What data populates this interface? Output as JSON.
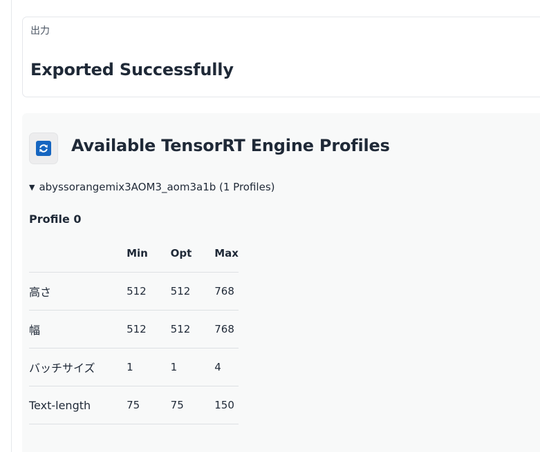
{
  "output": {
    "label": "出力",
    "message": "Exported Successfully"
  },
  "profiles_panel": {
    "title": "Available TensorRT Engine Profiles",
    "refresh_icon": "refresh-icon",
    "colors": {
      "icon_blue": "#1565c0",
      "panel_bg": "#f8f9f9"
    },
    "model": {
      "caret": "▼",
      "summary": "abyssorangemix3AOM3_aom3a1b (1 Profiles)"
    },
    "profile": {
      "heading": "Profile 0",
      "columns": [
        "",
        "Min",
        "Opt",
        "Max"
      ],
      "rows": [
        {
          "param": "高さ",
          "min": "512",
          "opt": "512",
          "max": "768"
        },
        {
          "param": "幅",
          "min": "512",
          "opt": "512",
          "max": "768"
        },
        {
          "param": "バッチサイズ",
          "min": "1",
          "opt": "1",
          "max": "4"
        },
        {
          "param": "Text-length",
          "min": "75",
          "opt": "75",
          "max": "150"
        }
      ]
    }
  }
}
